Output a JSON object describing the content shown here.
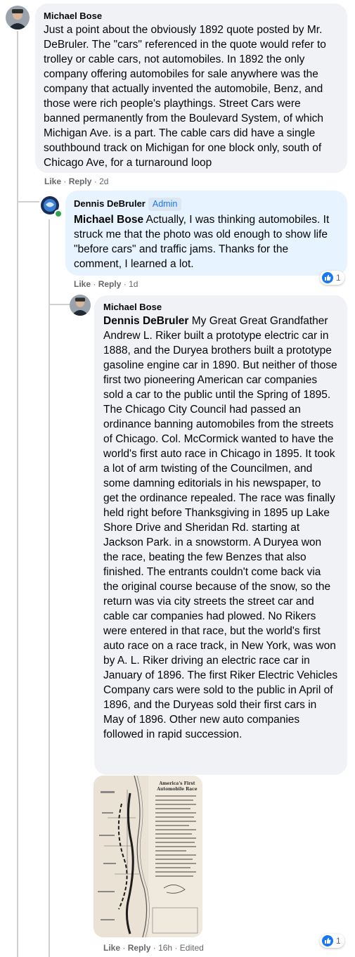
{
  "comments": [
    {
      "author": "Michael Bose",
      "text": "Just a point about the obviously 1892 quote posted by Mr. DeBruler. The \"cars\" referenced in the quote would refer to trolley or cable cars, not automobiles. In 1892 the only company offering automobiles for sale anywhere was the company that actually invented the automobile, Benz, and those were rich people's playthings. Street Cars were banned permanently from the Boulevard System, of which Michigan Ave. is a part. The cable cars did have a single southbound track on Michigan for one block only, south of Chicago Ave, for a turnaround loop",
      "like": "Like",
      "reply": "Reply",
      "time": "2d"
    },
    {
      "author": "Dennis DeBruler",
      "badge": "Admin",
      "mention": "Michael Bose",
      "text": " Actually, I was thinking automobiles. It struck me that the photo was old enough to show life \"before cars\" and traffic jams. Thanks for the comment, I learned a lot.",
      "like": "Like",
      "reply": "Reply",
      "time": "1d",
      "reaction_count": "1"
    },
    {
      "author": "Michael Bose",
      "mention": "Dennis DeBruler",
      "text": " My Great Great Grandfather Andrew L. Riker built a prototype electric car in 1888, and the Duryea brothers built a prototype gasoline engine car in 1890. But neither of those first two pioneering American car companies sold a car to the public until the Spring of 1895. The Chicago City Council had passed an ordinance banning automobiles from the streets of Chicago. Col. McCormick wanted to have the world's first auto race in Chicago in 1895. It took a lot of arm twisting of the Councilmen, and some damning editorials in his newspaper, to get the ordinance repealed. The race was finally held right before Thanksgiving in 1895 up Lake Shore Drive and Sheridan Rd. starting at Jackson Park. in a snowstorm. A Duryea won the race, beating the few Benzes that also finished. The entrants couldn't come back via the original course because of the snow, so the return was via city streets the street car and cable car companies had plowed. No Rikers were entered in that race, but the world's first auto race on a race track, in New York, was won by A. L. Riker driving an electric race car in January of 1896. The first Riker Electric Vehicles Company cars were sold to the public in April of 1896, and the Duryeas sold their first cars in May of 1896. Other new auto companies followed in rapid succession.",
      "image_title": "America's First Automobile Race",
      "like": "Like",
      "reply": "Reply",
      "time": "16h",
      "edited": "Edited",
      "reaction_count": "1"
    }
  ],
  "separator": "·",
  "colors": {
    "bubble": "#f0f2f5",
    "highlight": "#e7f3ff",
    "accent": "#1877f2",
    "meta": "#65676b"
  }
}
